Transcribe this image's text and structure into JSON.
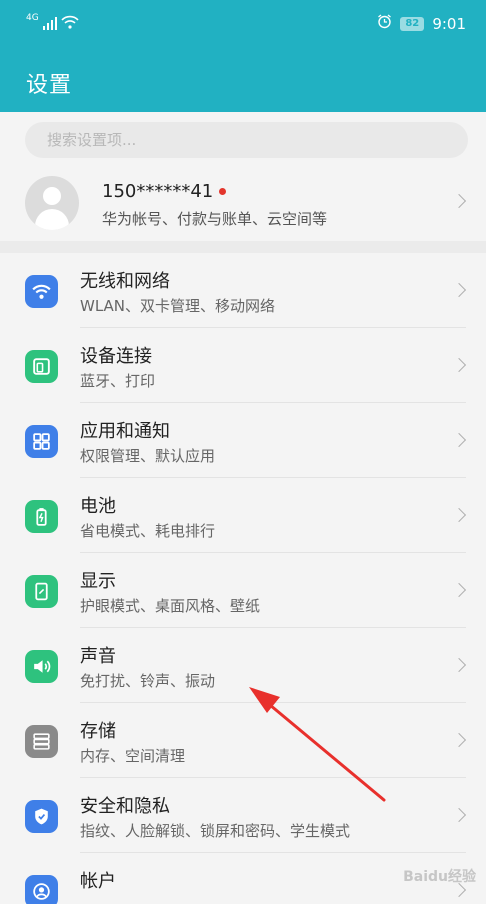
{
  "status_bar": {
    "signal_label": "4G",
    "battery": "82",
    "time": "9:01",
    "icons": [
      "signal-icon",
      "wifi-icon",
      "alarm-icon",
      "battery-icon"
    ]
  },
  "header": {
    "title": "设置",
    "background": "#21b1c2"
  },
  "search": {
    "placeholder": "搜索设置项..."
  },
  "account": {
    "name": "150******41",
    "subtitle": "华为帐号、付款与账单、云空间等"
  },
  "settings": [
    {
      "title": "无线和网络",
      "subtitle": "WLAN、双卡管理、移动网络",
      "icon": "wifi-icon",
      "color": "#3f7fe8"
    },
    {
      "title": "设备连接",
      "subtitle": "蓝牙、打印",
      "icon": "device-connect-icon",
      "color": "#2ec27e"
    },
    {
      "title": "应用和通知",
      "subtitle": "权限管理、默认应用",
      "icon": "apps-grid-icon",
      "color": "#3f7fe8"
    },
    {
      "title": "电池",
      "subtitle": "省电模式、耗电排行",
      "icon": "battery-icon",
      "color": "#2ec27e"
    },
    {
      "title": "显示",
      "subtitle": "护眼模式、桌面风格、壁纸",
      "icon": "display-icon",
      "color": "#2ec27e"
    },
    {
      "title": "声音",
      "subtitle": "免打扰、铃声、振动",
      "icon": "speaker-icon",
      "color": "#2ec27e"
    },
    {
      "title": "存储",
      "subtitle": "内存、空间清理",
      "icon": "storage-icon",
      "color": "#8a8a8a"
    },
    {
      "title": "安全和隐私",
      "subtitle": "指纹、人脸解锁、锁屏和密码、学生模式",
      "icon": "shield-icon",
      "color": "#3f7fe8"
    },
    {
      "title": "帐户",
      "subtitle": "",
      "icon": "account-icon",
      "color": "#3f7fe8"
    }
  ],
  "annotation": {
    "arrow_color": "#e8302c"
  },
  "watermark": {
    "text": "Baidu经验"
  }
}
